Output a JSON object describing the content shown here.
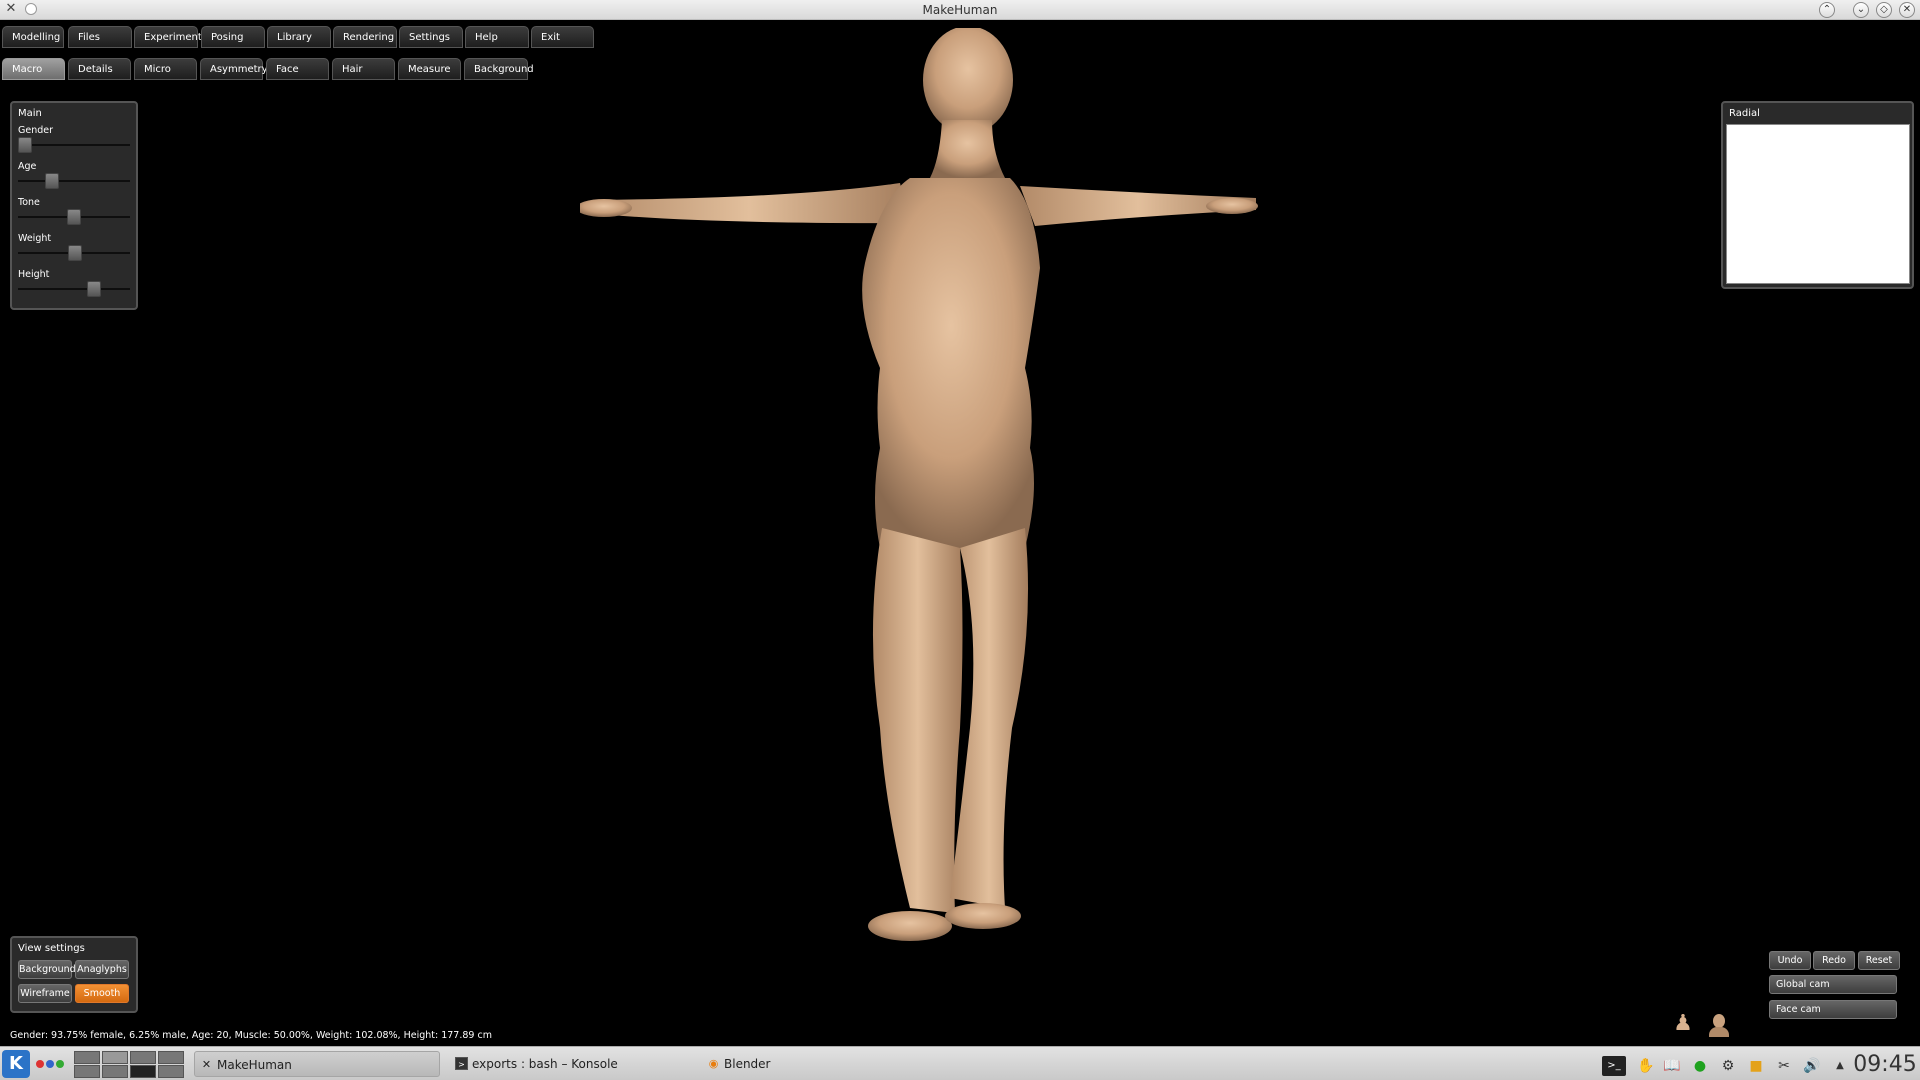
{
  "window": {
    "title": "MakeHuman"
  },
  "top_tabs": [
    "Modelling",
    "Files",
    "Experiments",
    "Posing",
    "Library",
    "Rendering",
    "Settings",
    "Help",
    "Exit"
  ],
  "sub_tabs": [
    "Macro",
    "Details",
    "Micro",
    "Asymmetry",
    "Face",
    "Hair",
    "Measure",
    "Background"
  ],
  "main_panel": {
    "title": "Main",
    "sliders": [
      {
        "label": "Gender",
        "value": 0.0625
      },
      {
        "label": "Age",
        "value": 0.3
      },
      {
        "label": "Tone",
        "value": 0.5
      },
      {
        "label": "Weight",
        "value": 0.51
      },
      {
        "label": "Height",
        "value": 0.68
      }
    ]
  },
  "radial_panel": {
    "title": "Radial"
  },
  "view_settings": {
    "title": "View settings",
    "background": "Background",
    "anaglyphs": "Anaglyphs",
    "wireframe": "Wireframe",
    "smooth": "Smooth"
  },
  "actions": {
    "undo": "Undo",
    "redo": "Redo",
    "reset": "Reset",
    "global_cam": "Global cam",
    "face_cam": "Face cam"
  },
  "status": "Gender: 93.75% female, 6.25% male, Age: 20, Muscle: 50.00%, Weight: 102.08%, Height: 177.89 cm",
  "taskbar": {
    "tasks": [
      "MakeHuman",
      "exports : bash – Konsole",
      "Blender"
    ],
    "clock": "09:45"
  },
  "colors": {
    "accent": "#e57d24",
    "skin": "#d9b28f"
  }
}
